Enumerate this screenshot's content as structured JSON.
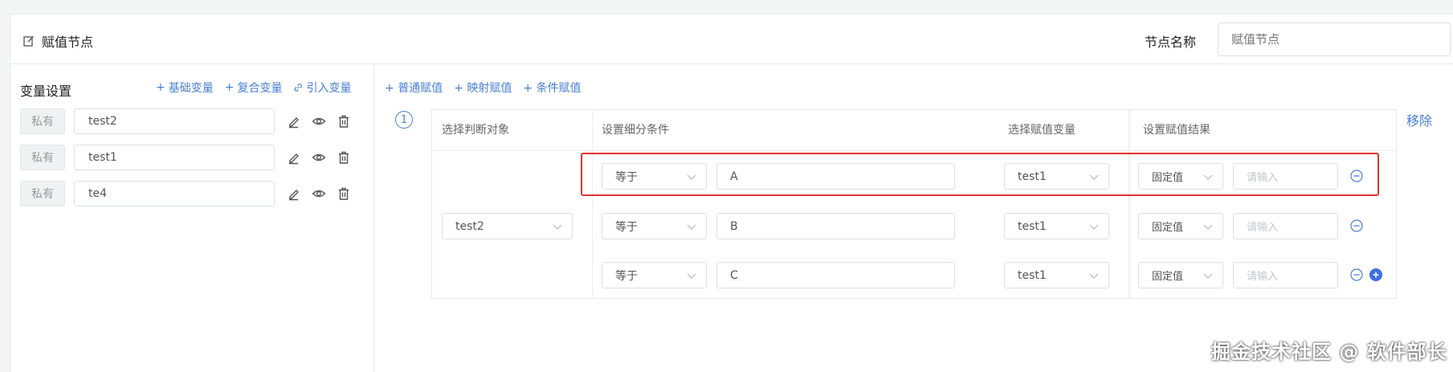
{
  "header": {
    "title": "赋值节点",
    "title_icon": "edit-icon",
    "name_label": "节点名称",
    "name_placeholder": "赋值节点"
  },
  "left": {
    "section_title": "变量设置",
    "actions": [
      {
        "icon": "plus-icon",
        "label": "基础变量"
      },
      {
        "icon": "plus-icon",
        "label": "复合变量"
      },
      {
        "icon": "link-icon",
        "label": "引入变量"
      }
    ],
    "variables": [
      {
        "tag": "私有",
        "name": "test2"
      },
      {
        "tag": "私有",
        "name": "test1"
      },
      {
        "tag": "私有",
        "name": "te4"
      }
    ]
  },
  "right": {
    "actions": [
      {
        "icon": "plus-icon",
        "label": "普通赋值"
      },
      {
        "icon": "plus-icon",
        "label": "映射赋值"
      },
      {
        "icon": "plus-icon",
        "label": "条件赋值"
      }
    ],
    "step_number": "1",
    "remove_label": "移除",
    "columns": [
      "选择判断对象",
      "设置细分条件",
      "选择赋值变量",
      "设置赋值结果"
    ],
    "target_object": "test2",
    "rows": [
      {
        "operator": "等于",
        "value": "A",
        "variable": "test1",
        "result_type": "固定值",
        "result_placeholder": "请输入"
      },
      {
        "operator": "等于",
        "value": "B",
        "variable": "test1",
        "result_type": "固定值",
        "result_placeholder": "请输入"
      },
      {
        "operator": "等于",
        "value": "C",
        "variable": "test1",
        "result_type": "固定值",
        "result_placeholder": "请输入"
      }
    ]
  },
  "watermark": "掘金技术社区 @ 软件部长",
  "colors": {
    "accent": "#4a7fd6",
    "highlight": "#e0342f",
    "border": "#dcdfe6"
  }
}
